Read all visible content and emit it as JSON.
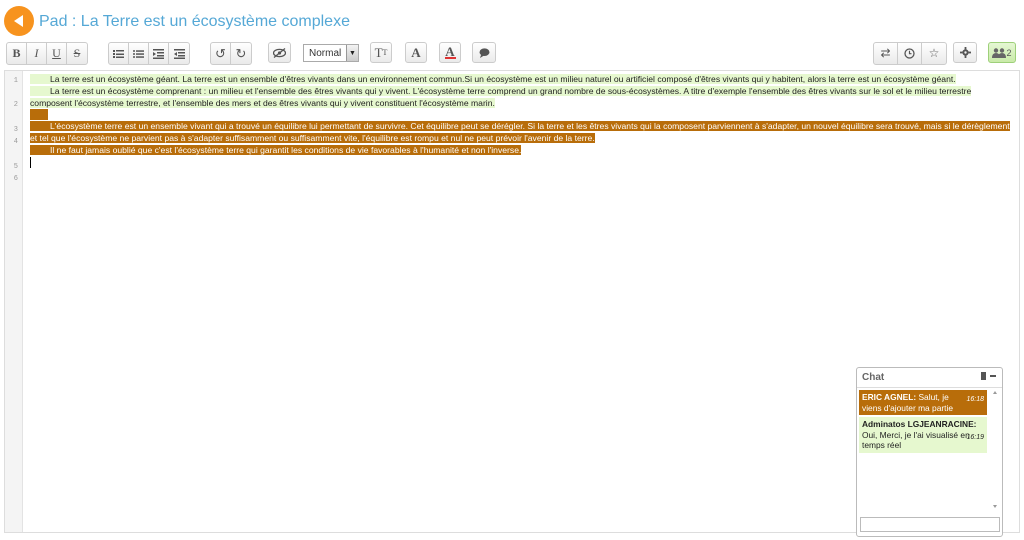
{
  "header": {
    "title": "Pad : La Terre est un écosystème complexe"
  },
  "toolbar": {
    "bold": "B",
    "italic": "I",
    "underline": "U",
    "strike": "S",
    "heading_select": "Normal",
    "font_size": "T",
    "font_color_a": "A",
    "font_color_b": "A",
    "user_count": "2"
  },
  "editor": {
    "line_numbers": [
      "1",
      "2",
      "3",
      "4",
      "5",
      "6"
    ],
    "line1": "La terre est un écosystème géant. La terre est un ensemble d'êtres vivants dans un environnement commun.Si un écosystème est un milieu naturel ou artificiel composé d'êtres vivants qui y habitent, alors la terre est un écosystème géant.",
    "line2": "La terre est un écosystème comprenant : un milieu et l'ensemble des êtres vivants qui y vivent. L'écosystème terre comprend un grand nombre de sous-écosystèmes. A titre d'exemple l'ensemble des êtres vivants sur le sol et le milieu terrestre composent l'écosystème terrestre, et l'ensemble des mers et des êtres vivants qui y vivent constituent l'écosystème marin.",
    "line4": "L'écosystème terre est un ensemble vivant qui a trouvé un équilibre lui permettant de survivre. Cet équilibre peut se dérégler. Si la terre et les êtres vivants qui la composent parviennent à s'adapter, un nouvel équilibre sera trouvé, mais si le dérèglement et tel que l'écosystème ne parvient pas à s'adapter suffisamment ou suffisamment vite, l'équilibre est rompu et nul ne peut prévoir l'avenir de la terre.",
    "line5": "Il ne faut jamais oublié que c'est l'écosystème terre qui garantit les conditions de vie favorables à l'humanité et non l'inverse."
  },
  "chat": {
    "title": "Chat",
    "messages": [
      {
        "author": "ERIC AGNEL:",
        "text": " Salut, je viens d'ajouter ma partie",
        "time": "16:18"
      },
      {
        "author": "Adminatos LGJEANRACINE:",
        "text": " Oui, Merci, je l'ai visualisé en temps réel",
        "time": "16:19"
      }
    ]
  },
  "colors": {
    "author_orange": "#b86d0a",
    "author_green": "#e6f8cf",
    "title_blue": "#55a8d6",
    "back_orange": "#f7931e"
  }
}
